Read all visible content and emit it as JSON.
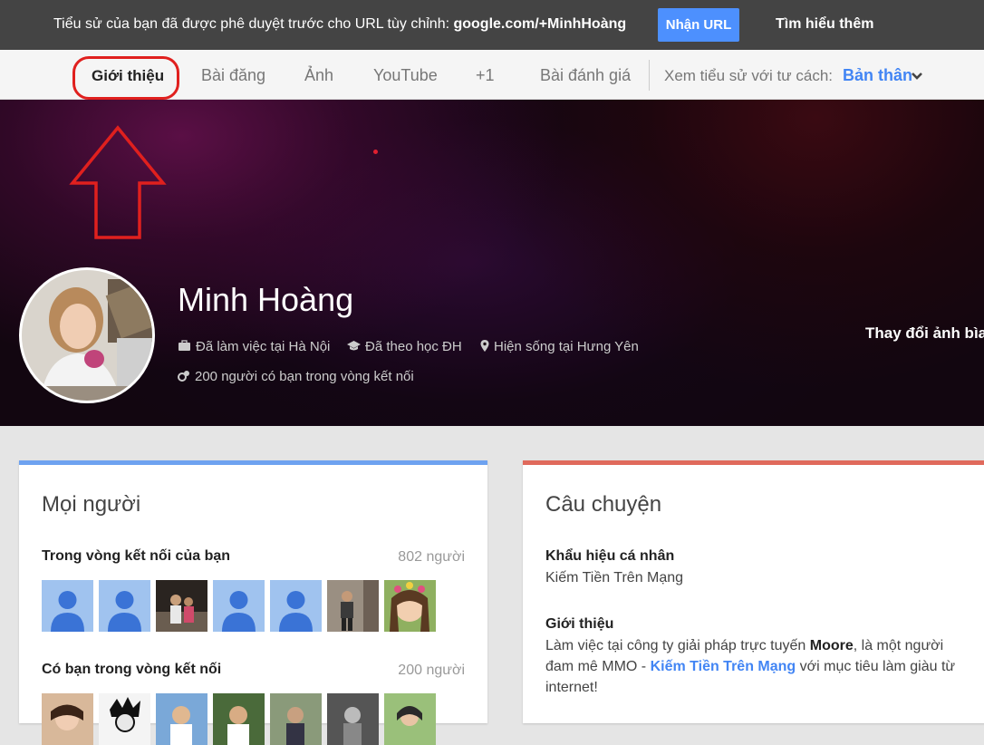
{
  "topbar": {
    "message_prefix": "Tiểu sử của bạn đã được phê duyệt trước cho URL tùy chỉnh: ",
    "message_url": "google.com/+MinhHoàng",
    "get_url_button": "Nhận URL",
    "learn_more": "Tìm hiểu thêm"
  },
  "tabs": {
    "about": "Giới thiệu",
    "posts": "Bài đăng",
    "photos": "Ảnh",
    "youtube": "YouTube",
    "plus_one": "+1",
    "reviews": "Bài đánh giá",
    "view_as_label": "Xem tiểu sử với tư cách:",
    "view_as_value": "Bản thân"
  },
  "profile": {
    "name": "Minh Hoàng",
    "work": "Đã làm việc tại Hà Nội",
    "education": "Đã theo học ĐH",
    "lives": "Hiện sống tại Hưng Yên",
    "circles": "200 người có bạn trong vòng kết nối",
    "change_cover": "Thay đổi ảnh bìa"
  },
  "people_card": {
    "title": "Mọi người",
    "in_circles_label": "Trong vòng kết nối của bạn",
    "in_circles_count": "802 người",
    "have_you_label": "Có bạn trong vòng kết nối",
    "have_you_count": "200 người"
  },
  "story_card": {
    "title": "Câu chuyện",
    "tagline_label": "Khẩu hiệu cá nhân",
    "tagline_value": "Kiếm Tiền Trên Mạng",
    "intro_label": "Giới thiệu",
    "intro_part1": "Làm việc tại công ty giải pháp trực tuyến ",
    "intro_bold": "Moore",
    "intro_part2": ", là một người đam mê MMO - ",
    "intro_link": "Kiếm Tiền Trên Mạng",
    "intro_part3": " với mục tiêu làm giàu từ internet!"
  },
  "colors": {
    "accent_blue": "#4285f4",
    "annotation_red": "#e0201e",
    "people_card_top": "#6ea2f0",
    "story_card_top": "#e06a5c"
  }
}
